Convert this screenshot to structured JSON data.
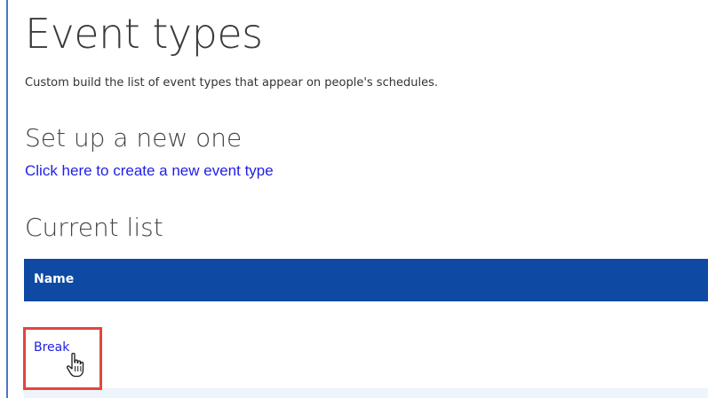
{
  "page": {
    "title": "Event types",
    "subtitle": "Custom build the list of event types that appear on people's schedules."
  },
  "setup_section": {
    "heading": "Set up a new one",
    "create_link": "Click here to create a new event type"
  },
  "list_section": {
    "heading": "Current list",
    "columns": [
      "Name"
    ],
    "rows": [
      {
        "name": "Break"
      }
    ]
  },
  "colors": {
    "header_bg": "#0e4aa3",
    "link": "#1f1fe6",
    "highlight": "#e0463f",
    "accent_rule": "#4a78c2"
  },
  "icons": {
    "cursor": "hand-pointer-icon"
  }
}
